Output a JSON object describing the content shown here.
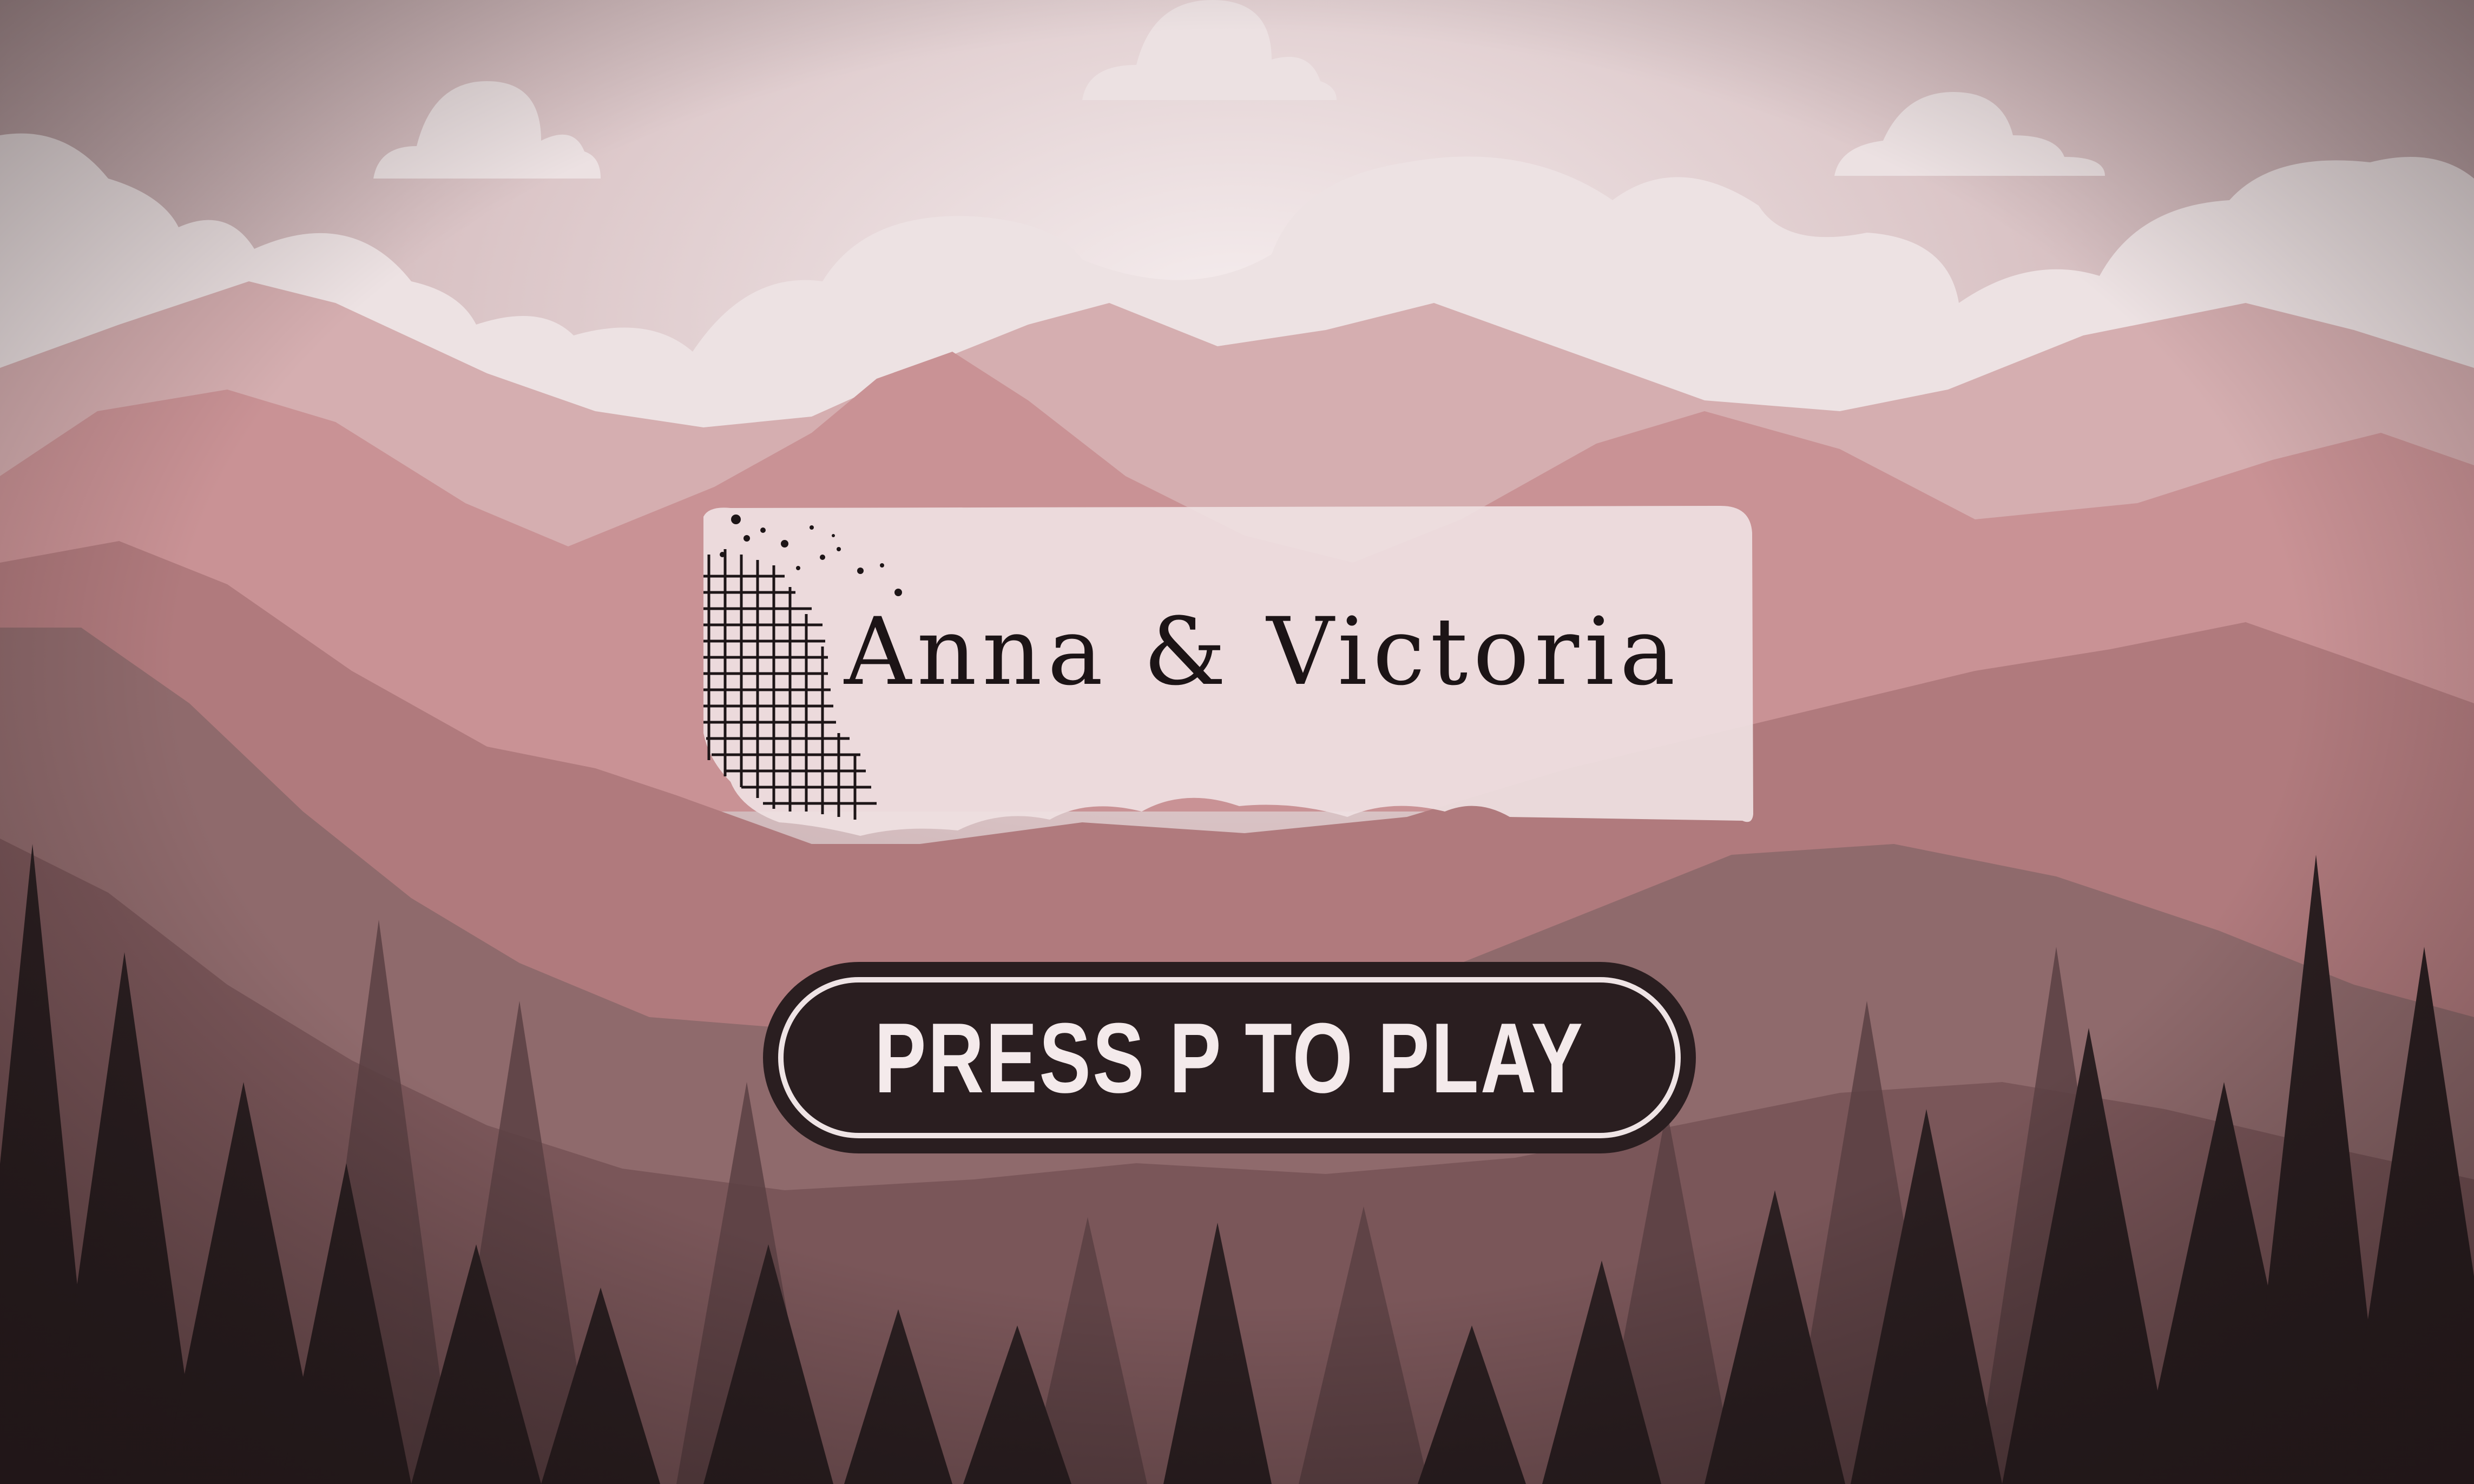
{
  "game": {
    "title": "Anna & Victoria",
    "start_prompt": "PRESS P TO PLAY"
  },
  "colors": {
    "sky_top": "#a98e91",
    "sky_glow": "#f1e6e7",
    "cloud": "#ede3e4",
    "mountain_far": "#d3a9ab",
    "mountain_mid": "#c98f92",
    "mountain_near": "#a47476",
    "hill_dark": "#7e5b5e",
    "forest": "#2a1e20",
    "card": "#eedfe0",
    "button": "#2a1e20",
    "button_text": "#f4eaeb"
  },
  "icons": {
    "title_decoration": "grid-scribble-icon"
  }
}
